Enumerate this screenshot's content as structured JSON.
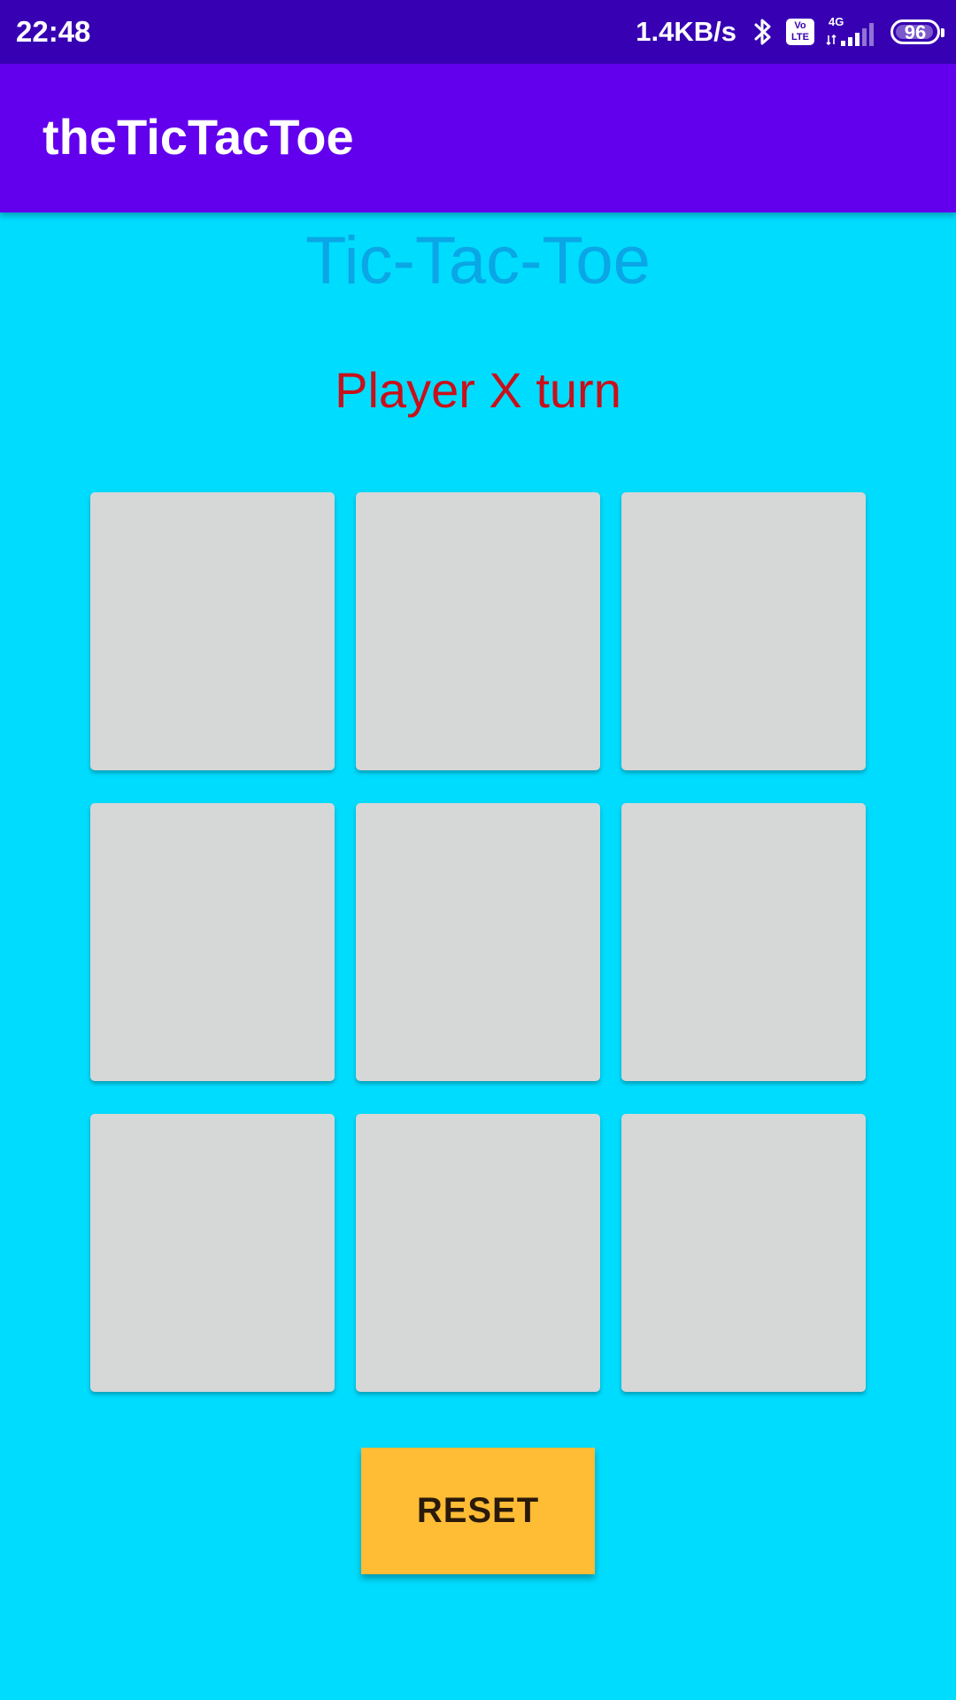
{
  "status_bar": {
    "time": "22:48",
    "net_speed": "1.4KB/s",
    "volte_label_top": "Vo",
    "volte_label_bottom": "LTE",
    "network_type": "4G",
    "battery": "96",
    "battery_level": 0.96,
    "icons": [
      "bluetooth-icon",
      "volte-icon",
      "signal-icon",
      "battery-icon"
    ]
  },
  "app_bar": {
    "title": "theTicTacToe"
  },
  "game": {
    "title": "Tic-Tac-Toe",
    "turn_text": "Player X turn",
    "board": [
      [
        "",
        "",
        ""
      ],
      [
        "",
        "",
        ""
      ],
      [
        "",
        "",
        ""
      ]
    ],
    "reset_label": "RESET"
  },
  "colors": {
    "background": "#00DCFE",
    "status_bar": "#3700B3",
    "app_bar": "#6200EE",
    "title_text": "#0AA6E6",
    "turn_text": "#C8101A",
    "cell": "#D6D7D7",
    "reset_button": "#FFBC35"
  }
}
